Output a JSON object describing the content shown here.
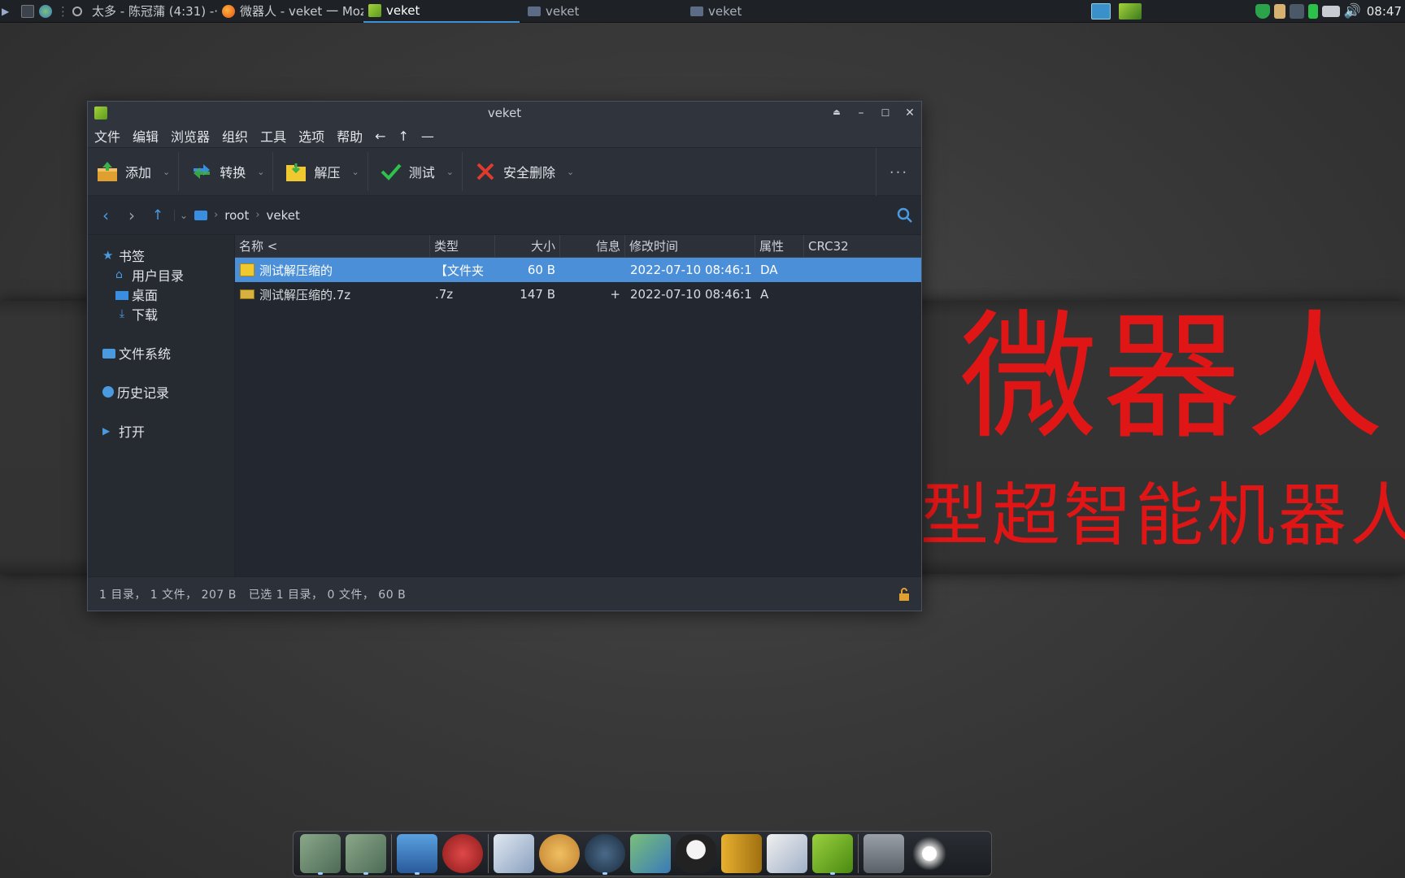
{
  "panel": {
    "tasks": [
      {
        "label": "太多 - 陈冠蒲 (4:31) -···"
      },
      {
        "label": "微器人 - veket 一 Moz···"
      },
      {
        "label": "veket"
      },
      {
        "label": "veket"
      },
      {
        "label": "veket"
      }
    ],
    "clock": "08:47"
  },
  "banner": {
    "line1": "微器人",
    "line2": "型超智能机器人"
  },
  "window": {
    "title": "veket",
    "menu": [
      "文件",
      "编辑",
      "浏览器",
      "组织",
      "工具",
      "选项",
      "帮助",
      "←",
      "↑",
      "—"
    ],
    "toolbar": {
      "add": "添加",
      "convert": "转换",
      "extract": "解压",
      "test": "测试",
      "secure_delete": "安全删除",
      "more": "···"
    },
    "breadcrumb": [
      "root",
      "veket"
    ],
    "sidebar": {
      "bookmarks": "书签",
      "home": "用户目录",
      "desktop": "桌面",
      "downloads": "下载",
      "filesystem": "文件系统",
      "history": "历史记录",
      "open": "打开"
    },
    "columns": [
      "名称 <",
      "类型",
      "大小",
      "信息",
      "修改时间",
      "属性",
      "CRC32"
    ],
    "rows": [
      {
        "name": "测试解压缩的",
        "type": "【文件夹",
        "size": "60 B",
        "info": "",
        "modified": "2022-07-10 08:46:1",
        "attr": "DA",
        "crc": "",
        "selected": true
      },
      {
        "name": "测试解压缩的.7z",
        "type": ".7z",
        "size": "147 B",
        "info": "+",
        "modified": "2022-07-10 08:46:1",
        "attr": "A",
        "crc": "",
        "selected": false
      }
    ],
    "status": "1 目录， 1 文件， 207 B   已选 1 目录， 0 文件， 60 B"
  },
  "colors": {
    "accent": "#4a8fd8",
    "banner_red": "#e01616"
  }
}
